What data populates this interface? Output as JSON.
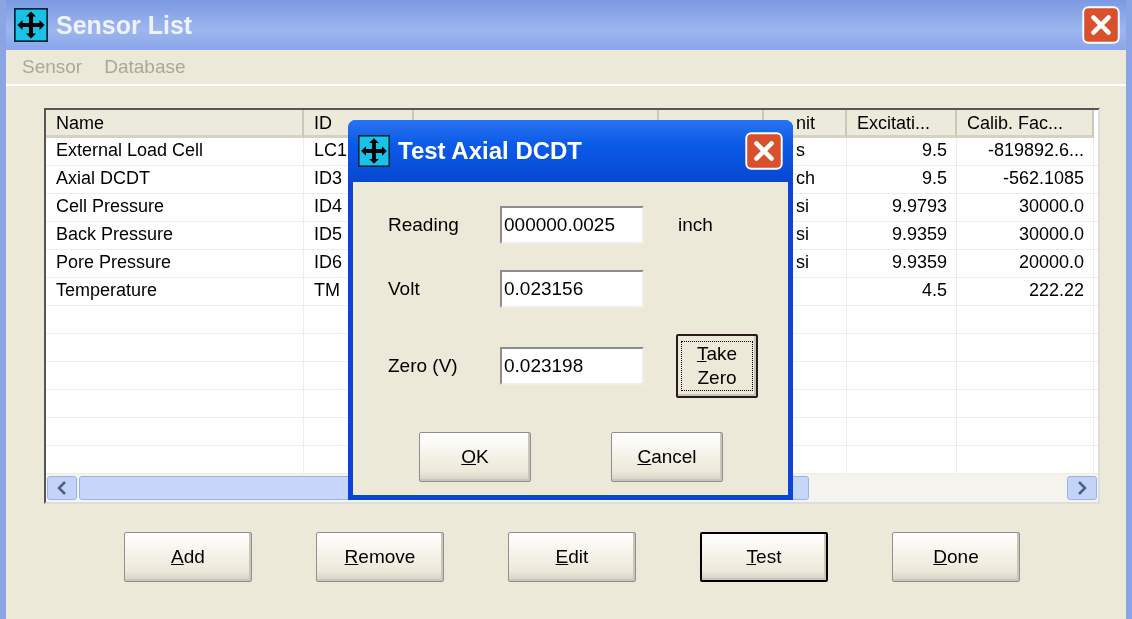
{
  "window": {
    "title": "Sensor List"
  },
  "menu": [
    {
      "label": "Sensor",
      "disabled": true
    },
    {
      "label": "Database",
      "disabled": true
    }
  ],
  "table": {
    "columns": [
      "Name",
      "ID",
      "nit",
      "Excitati...",
      "Calib. Fac..."
    ],
    "rows": [
      {
        "name": "External Load Cell",
        "id": "LC1",
        "column_5": "s",
        "excitation": "9.5",
        "calib": "-819892.6..."
      },
      {
        "name": "Axial DCDT",
        "id": "ID3",
        "column_5": "ch",
        "excitation": "9.5",
        "calib": "-562.1085"
      },
      {
        "name": "Cell Pressure",
        "id": "ID4",
        "column_5": "si",
        "excitation": "9.9793",
        "calib": "30000.0"
      },
      {
        "name": "Back Pressure",
        "id": "ID5",
        "column_5": "si",
        "excitation": "9.9359",
        "calib": "30000.0"
      },
      {
        "name": "Pore Pressure",
        "id": "ID6",
        "column_5": "si",
        "excitation": "9.9359",
        "calib": "20000.0"
      },
      {
        "name": "Temperature",
        "id": "TM",
        "excitation": "4.5",
        "calib": "222.22"
      }
    ]
  },
  "buttons": [
    {
      "label": "Add",
      "default": false
    },
    {
      "label": "Remove",
      "default": false
    },
    {
      "label": "Edit",
      "default": false
    },
    {
      "label": "Test",
      "default": true
    },
    {
      "label": "Done",
      "default": false
    }
  ],
  "dialog": {
    "title": "Test Axial DCDT",
    "fields": [
      {
        "label": "Reading",
        "value": "000000.0025",
        "unit": "inch"
      },
      {
        "label": "Volt",
        "value": "0.023156"
      },
      {
        "label": "Zero (V)",
        "value": "0.023198"
      }
    ],
    "take_zero": {
      "label": "Take Zero",
      "focused": true
    },
    "buttons": [
      {
        "label": "OK"
      },
      {
        "label": "Cancel"
      }
    ]
  }
}
